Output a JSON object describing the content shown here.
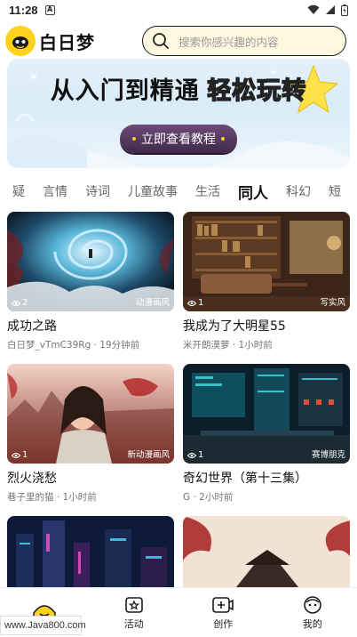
{
  "status_bar": {
    "time": "11:28",
    "notif_letter": "A"
  },
  "header": {
    "logo_text": "白日梦",
    "search_placeholder": "搜索你感兴趣的内容"
  },
  "banner": {
    "title_part1": "从入门到精通",
    "title_part2": "轻松玩转",
    "button_label": "立即查看教程"
  },
  "tabs": [
    "疑",
    "言情",
    "诗词",
    "儿童故事",
    "生活",
    "同人",
    "科幻",
    "短"
  ],
  "active_tab_index": 5,
  "cards": [
    {
      "title": "成功之路",
      "author": "白日梦_vTmC39Rg",
      "time": "19分钟前",
      "views": "2",
      "style": "动漫画风",
      "thumb": "swirl"
    },
    {
      "title": "我成为了大明星55",
      "author": "米开朗漠萝",
      "time": "1小时前",
      "views": "1",
      "style": "写实风",
      "thumb": "study"
    },
    {
      "title": "烈火浇愁",
      "author": "巷子里的猫",
      "time": "1小时前",
      "views": "1",
      "style": "新动漫画风",
      "thumb": "warrior"
    },
    {
      "title": "奇幻世界（第十三集）",
      "author": "G",
      "time": "2小时前",
      "views": "1",
      "style": "赛博朋克",
      "thumb": "cyber"
    },
    {
      "title": "",
      "author": "",
      "time": "",
      "views": "",
      "style": "",
      "thumb": "city"
    },
    {
      "title": "",
      "author": "",
      "time": "",
      "views": "",
      "style": "",
      "thumb": "temple"
    }
  ],
  "bottom_nav": [
    {
      "label": "",
      "icon": "home-icon"
    },
    {
      "label": "活动",
      "icon": "activity-icon"
    },
    {
      "label": "创作",
      "icon": "create-icon"
    },
    {
      "label": "我的",
      "icon": "profile-icon"
    }
  ],
  "watermark": "www.Java800.com",
  "colors": {
    "brand_yellow": "#ffd21e",
    "search_bg": "#fff8e0",
    "banner_btn": "#4f3559"
  }
}
